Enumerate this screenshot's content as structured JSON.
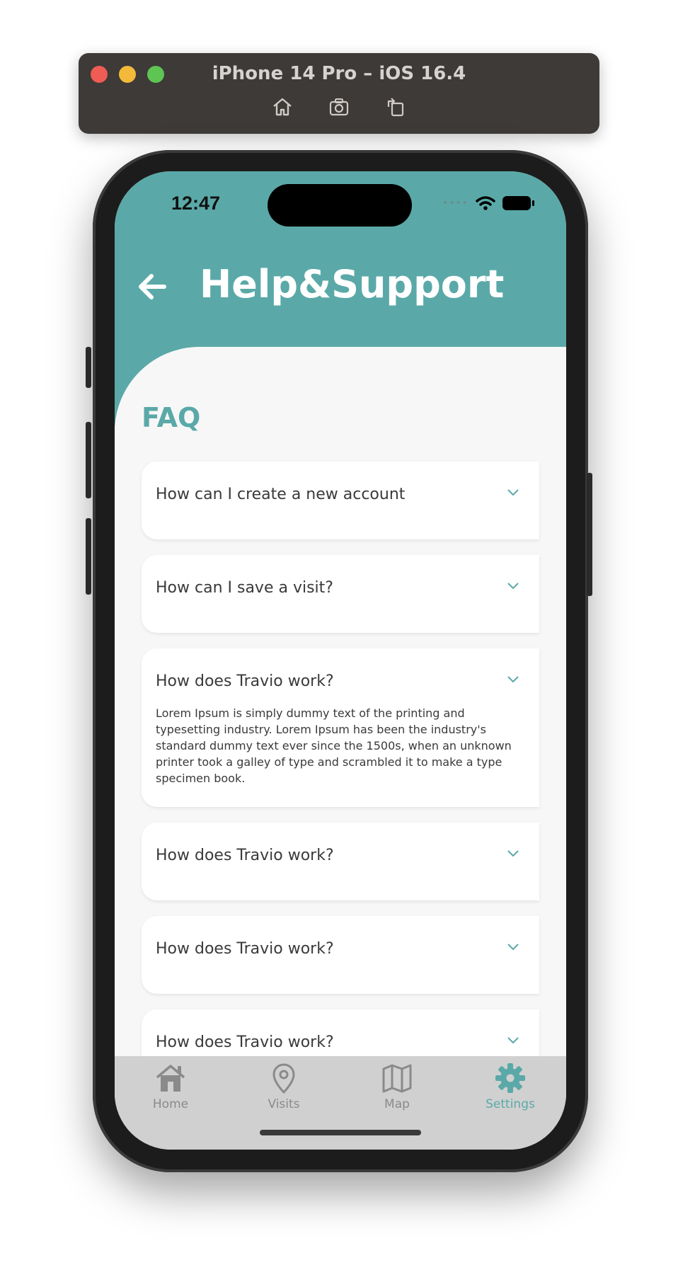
{
  "simulator": {
    "title": "iPhone 14 Pro – iOS 16.4",
    "icons": [
      "home-icon",
      "screenshot-icon",
      "rotate-icon"
    ]
  },
  "status_bar": {
    "time": "12:47",
    "icons": [
      "signal-icon",
      "wifi-icon",
      "battery-icon"
    ]
  },
  "header": {
    "title": "Help&Support",
    "back_icon": "back-arrow-icon"
  },
  "faq": {
    "title": "FAQ",
    "items": [
      {
        "question": "How can I create a new account",
        "answer": "",
        "expanded": false
      },
      {
        "question": "How can I save a visit?",
        "answer": "",
        "expanded": false
      },
      {
        "question": "How does Travio work?",
        "answer": "Lorem Ipsum is simply dummy text of the printing and typesetting industry. Lorem Ipsum has been the industry's standard dummy text ever since the 1500s, when an unknown printer took a galley of type and scrambled it to make a type specimen book.",
        "expanded": true
      },
      {
        "question": "How does Travio work?",
        "answer": "",
        "expanded": false
      },
      {
        "question": "How does Travio work?",
        "answer": "",
        "expanded": false
      },
      {
        "question": "How does Travio work?",
        "answer": "",
        "expanded": false
      }
    ]
  },
  "tabbar": {
    "items": [
      {
        "label": "Home",
        "icon": "home-icon",
        "active": false
      },
      {
        "label": "Visits",
        "icon": "location-pin-icon",
        "active": false
      },
      {
        "label": "Map",
        "icon": "map-icon",
        "active": false
      },
      {
        "label": "Settings",
        "icon": "gear-icon",
        "active": true
      }
    ]
  },
  "colors": {
    "accent": "#5aa9a8",
    "background": "#f7f7f7",
    "tabbar": "#d0d0d0",
    "inactive": "#8a8a8a"
  }
}
